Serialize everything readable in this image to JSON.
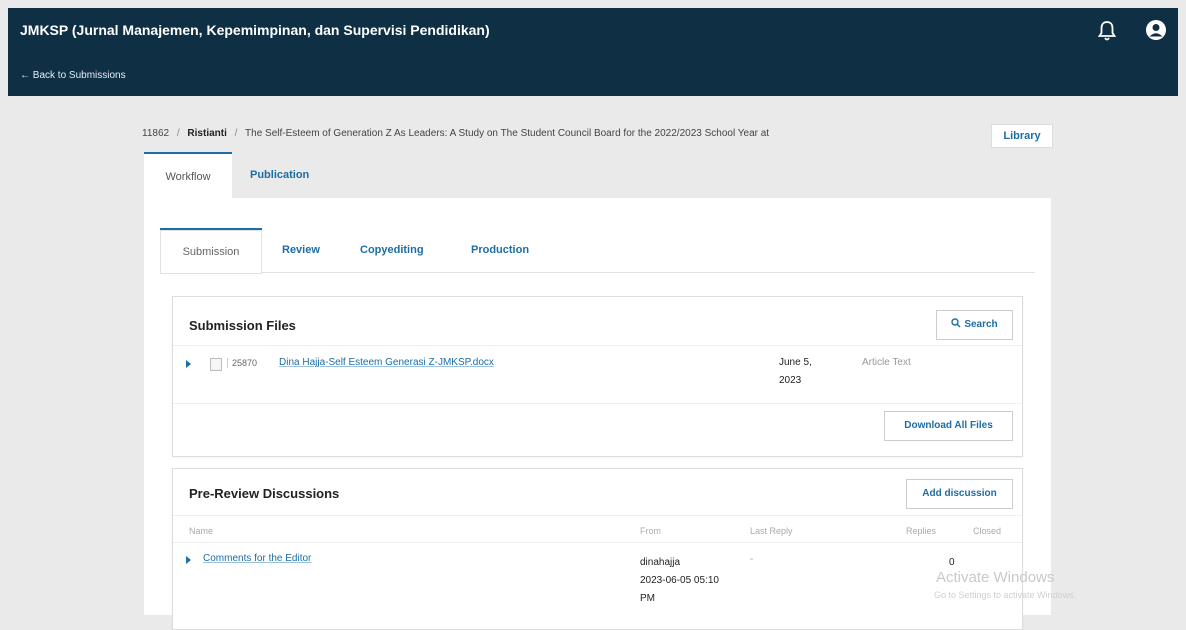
{
  "header": {
    "title": "JMKSP (Jurnal Manajemen, Kepemimpinan, dan Supervisi Pendidikan)",
    "back_link": "← Back to Submissions",
    "bell_icon": "bell-icon",
    "user_icon": "user-circle-icon"
  },
  "breadcrumb": {
    "id": "11862",
    "sep1": "/",
    "author": "Ristianti",
    "sep2": "/",
    "title": "The Self-Esteem of Generation Z As Leaders: A Study on The Student Council Board for the 2022/2023 School Year at"
  },
  "library_label": "Library",
  "outer_tabs": [
    {
      "label": "Workflow",
      "active": true
    },
    {
      "label": "Publication",
      "active": false
    }
  ],
  "inner_tabs": [
    {
      "label": "Submission",
      "active": true
    },
    {
      "label": "Review",
      "active": false
    },
    {
      "label": "Copyediting",
      "active": false
    },
    {
      "label": "Production",
      "active": false
    }
  ],
  "submission_files": {
    "title": "Submission Files",
    "search_label": "Search",
    "search_icon": "search-icon",
    "files": [
      {
        "id": "25870",
        "name": "Dina Hajja-Self Esteem Generasi Z-JMKSP.docx",
        "date_line1": "June 5,",
        "date_line2": "2023",
        "type": "Article Text"
      }
    ],
    "download_label": "Download All Files"
  },
  "discussions": {
    "title": "Pre-Review Discussions",
    "add_label": "Add discussion",
    "columns": [
      "Name",
      "From",
      "Last Reply",
      "Replies",
      "Closed"
    ],
    "rows": [
      {
        "name": "Comments for the Editor",
        "from_user": "dinahajja",
        "from_date": "2023-06-05 05:10",
        "from_time": "PM",
        "last_reply": "-",
        "replies": "0"
      }
    ]
  },
  "watermark": {
    "title": "Activate Windows",
    "subtitle": "Go to Settings to activate Windows."
  },
  "colors": {
    "header_bg": "#0f2f44",
    "accent": "#1c6ea4",
    "page_bg": "#eaeaea"
  }
}
